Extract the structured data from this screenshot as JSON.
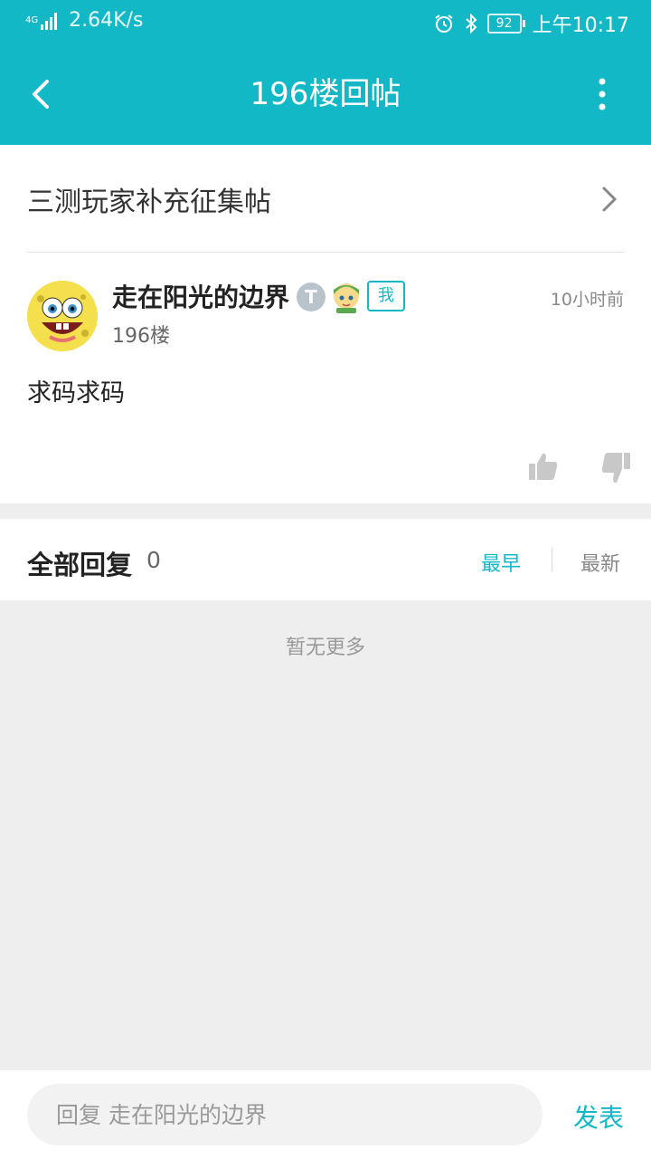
{
  "status_bar": {
    "signal_label": "4G",
    "net_speed": "2.64K/s",
    "battery": "92",
    "time": "上午10:17"
  },
  "navbar": {
    "title": "196楼回帖"
  },
  "topic": {
    "title": "三测玩家补充征集帖"
  },
  "post": {
    "username": "走在阳光的边界",
    "level_badge": "T",
    "me_tag": "我",
    "time": "10小时前",
    "floor": "196楼",
    "content": "求码求码"
  },
  "replies": {
    "label": "全部回复",
    "count": "0",
    "sort_earliest": "最早",
    "sort_latest": "最新",
    "empty_text": "暂无更多"
  },
  "bottom": {
    "reply_placeholder": "回复 走在阳光的边界",
    "send_label": "发表"
  },
  "colors": {
    "accent": "#13b8c7",
    "background": "#eeeeee"
  },
  "icons": [
    "signal-icon",
    "alarm-clock-icon",
    "bluetooth-icon",
    "battery-icon",
    "back-arrow-icon",
    "more-vertical-icon",
    "chevron-right-icon",
    "avatar-spongebob",
    "level-badge-icon",
    "character-badge-icon",
    "thumbs-up-icon",
    "thumbs-down-icon"
  ]
}
